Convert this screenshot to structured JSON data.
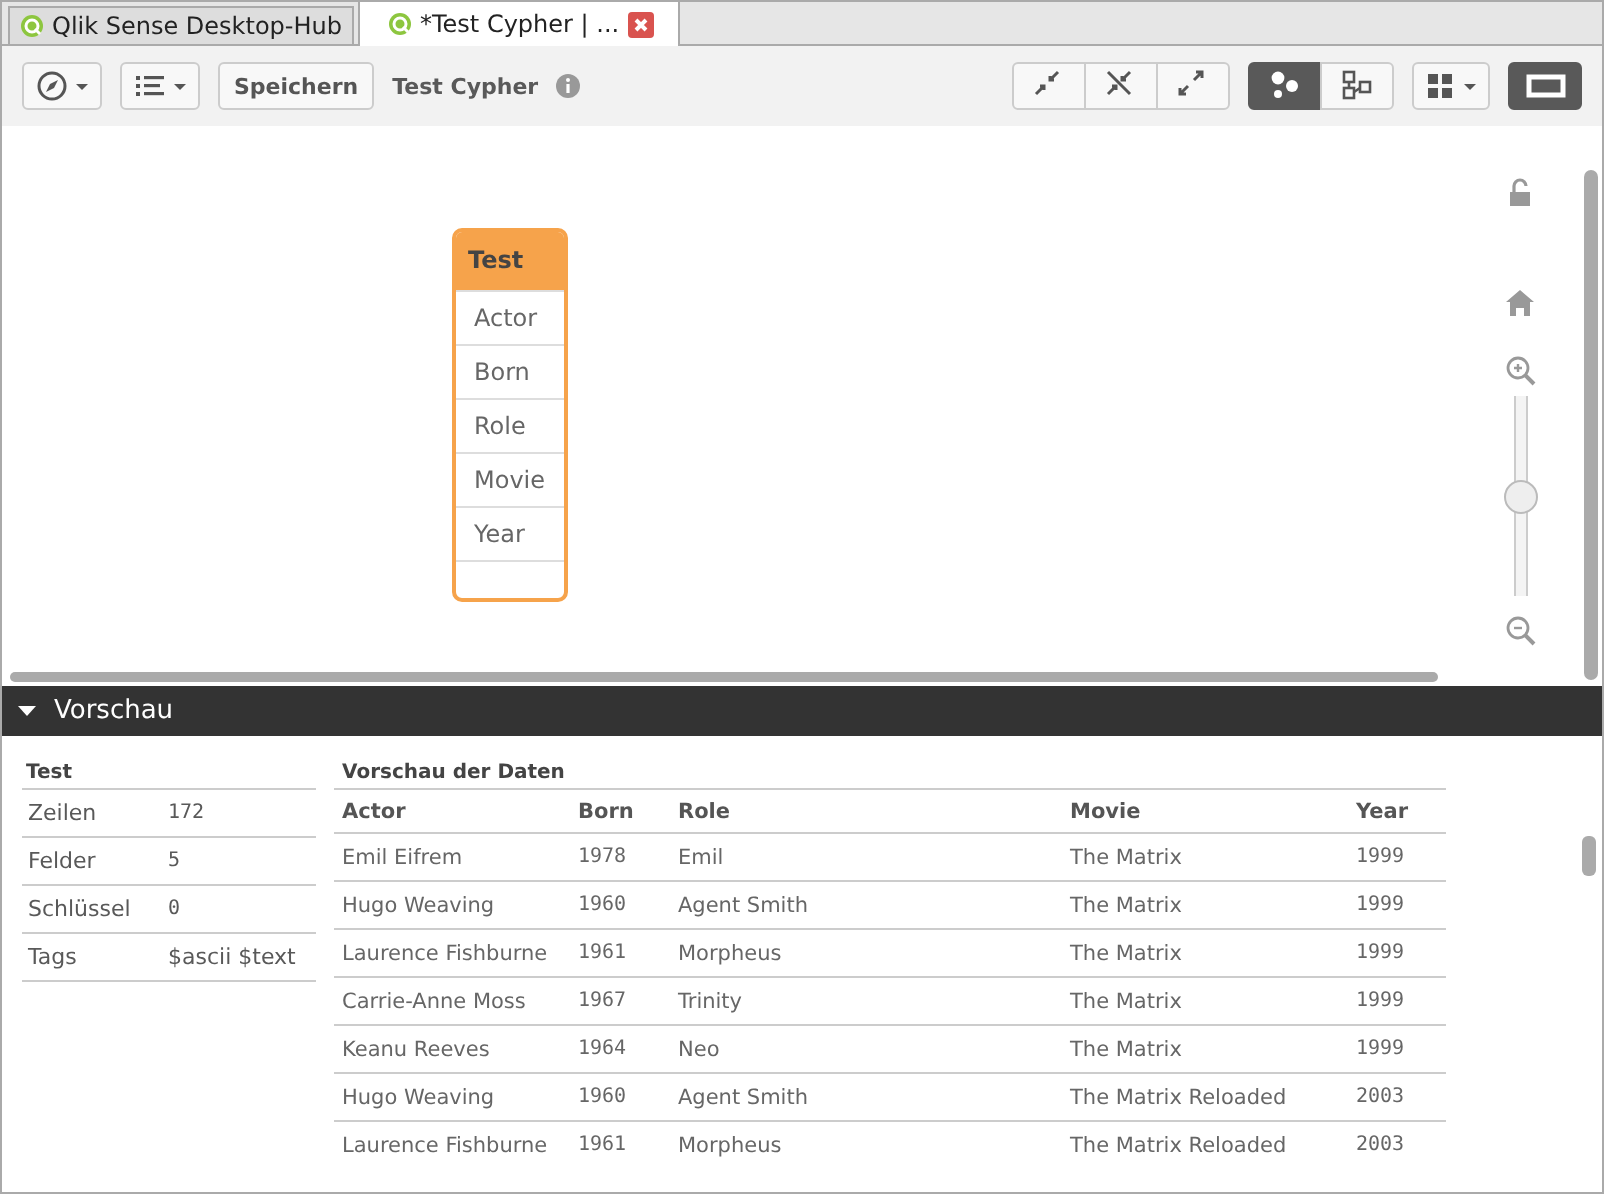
{
  "tabs": [
    {
      "label": "Qlik Sense Desktop-Hub",
      "selected": false,
      "closable": false
    },
    {
      "label": "*Test Cypher | ...",
      "selected": true,
      "closable": true
    }
  ],
  "toolbar": {
    "menus": [
      {
        "kind": "compass"
      },
      {
        "kind": "list"
      }
    ],
    "save_button": "Speichern",
    "app_title": "Test Cypher",
    "view_groups": [
      [
        {
          "kind": "collapse",
          "selected": false
        },
        {
          "kind": "collapse-cross",
          "selected": false
        },
        {
          "kind": "expand",
          "selected": false
        }
      ],
      [
        {
          "kind": "bubbles",
          "selected": true
        },
        {
          "kind": "linked-boxes",
          "selected": false
        }
      ],
      [
        {
          "kind": "grid-menu",
          "selected": false
        }
      ],
      [
        {
          "kind": "panel",
          "selected": true
        }
      ]
    ]
  },
  "canvas": {
    "table_card": {
      "title": "Test",
      "fields": [
        "Actor",
        "Born",
        "Role",
        "Movie",
        "Year"
      ]
    },
    "zoom": {
      "level": 0.5
    }
  },
  "preview": {
    "title": "Vorschau",
    "expanded": true,
    "table_info": {
      "title": "Test",
      "rows": [
        {
          "label": "Zeilen",
          "value": "172"
        },
        {
          "label": "Felder",
          "value": "5"
        },
        {
          "label": "Schlüssel",
          "value": "0"
        },
        {
          "label": "Tags",
          "value": "$ascii $text"
        }
      ]
    },
    "data_preview": {
      "title": "Vorschau der Daten",
      "columns": [
        "Actor",
        "Born",
        "Role",
        "Movie",
        "Year"
      ],
      "rows": [
        [
          "Emil Eifrem",
          "1978",
          "Emil",
          "The Matrix",
          "1999"
        ],
        [
          "Hugo Weaving",
          "1960",
          "Agent Smith",
          "The Matrix",
          "1999"
        ],
        [
          "Laurence Fishburne",
          "1961",
          "Morpheus",
          "The Matrix",
          "1999"
        ],
        [
          "Carrie-Anne Moss",
          "1967",
          "Trinity",
          "The Matrix",
          "1999"
        ],
        [
          "Keanu Reeves",
          "1964",
          "Neo",
          "The Matrix",
          "1999"
        ],
        [
          "Hugo Weaving",
          "1960",
          "Agent Smith",
          "The Matrix Reloaded",
          "2003"
        ],
        [
          "Laurence Fishburne",
          "1961",
          "Morpheus",
          "The Matrix Reloaded",
          "2003"
        ]
      ]
    }
  }
}
